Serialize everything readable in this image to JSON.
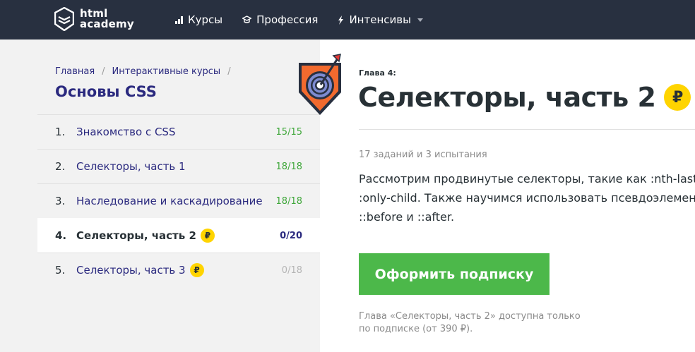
{
  "header": {
    "logo_line1": "html",
    "logo_line2": "academy",
    "nav": [
      {
        "label": "Курсы",
        "icon": "bar-chart-icon"
      },
      {
        "label": "Профессия",
        "icon": "graduation-cap-icon"
      },
      {
        "label": "Интенсивы",
        "icon": "lightning-icon"
      }
    ]
  },
  "sidebar": {
    "breadcrumbs": [
      "Главная",
      "Интерактивные курсы"
    ],
    "breadcrumb_sep": "/",
    "course_title": "Основы CSS",
    "chapters": [
      {
        "num": "1.",
        "title": "Знакомство с CSS",
        "count": "15/15",
        "paid": false
      },
      {
        "num": "2.",
        "title": "Селекторы, часть 1",
        "count": "18/18",
        "paid": false
      },
      {
        "num": "3.",
        "title": "Наследование и каскадирование",
        "count": "18/18",
        "paid": false
      },
      {
        "num": "4.",
        "title": "Селекторы, часть 2",
        "count": "0/20",
        "paid": true
      },
      {
        "num": "5.",
        "title": "Селекторы, часть 3",
        "count": "0/18",
        "paid": true
      }
    ],
    "ruble_symbol": "₽"
  },
  "main": {
    "chapter_label": "Глава 4:",
    "heading": "Селекторы, часть 2",
    "ruble_symbol": "₽",
    "tasks_info": "17 заданий и 3 испытания",
    "description_lines": [
      "Рассмотрим продвинутые селекторы, такие как :nth-last-child и",
      ":only-child. Также научимся использовать псевдоэлементы",
      "::before и ::after."
    ],
    "subscribe_label": "Оформить подписку",
    "note_lines": [
      "Глава «Селекторы, часть 2» доступна только",
      "по подписке (от 390 ₽)."
    ]
  },
  "colors": {
    "header_bg": "#283040",
    "accent_blue": "#2b2a7f",
    "success_green": "#3fa73a",
    "button_green": "#4cb84a",
    "ruble_yellow": "#ffd400",
    "shield_orange": "#f26a2e"
  }
}
